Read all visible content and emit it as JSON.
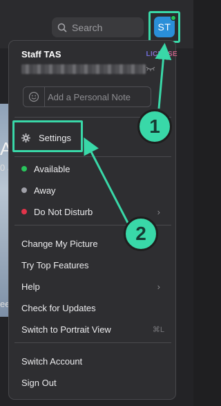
{
  "search": {
    "placeholder": "Search",
    "icon": "search-icon"
  },
  "avatar": {
    "initials": "ST",
    "status_color": "#26c65a"
  },
  "background_fragments": {
    "letter": "A",
    "text2": "0 J",
    "text3": "ee"
  },
  "profile": {
    "name": "Staff TAS",
    "license": "LICENSE",
    "note_placeholder": "Add a Personal Note"
  },
  "menu": {
    "settings": "Settings",
    "statuses": [
      {
        "label": "Available",
        "color": "#29c45c"
      },
      {
        "label": "Away",
        "color": "#a0a0a8"
      },
      {
        "label": "Do Not Disturb",
        "color": "#e2344a"
      }
    ],
    "items": {
      "change_picture": "Change My Picture",
      "top_features": "Try Top Features",
      "help": "Help",
      "check_updates": "Check for Updates",
      "portrait_view": "Switch to Portrait View",
      "portrait_shortcut": "⌘L",
      "switch_account": "Switch Account",
      "sign_out": "Sign Out"
    }
  },
  "annotations": {
    "badge1": "1",
    "badge2": "2",
    "accent": "#39d8a8"
  }
}
